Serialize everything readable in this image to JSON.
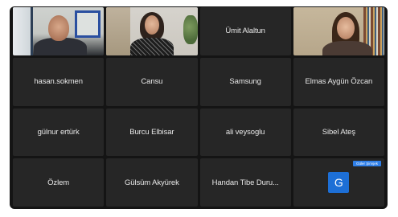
{
  "meeting": {
    "participants": [
      {
        "name": "",
        "type": "video",
        "scene": "man-in-room"
      },
      {
        "name": "",
        "type": "video",
        "scene": "woman-in-office"
      },
      {
        "name": "Ümit Alaltun",
        "type": "name"
      },
      {
        "name": "",
        "type": "video",
        "scene": "woman-with-bookshelf"
      },
      {
        "name": "hasan.sokmen",
        "type": "name"
      },
      {
        "name": "Cansu",
        "type": "name"
      },
      {
        "name": "Samsung",
        "type": "name"
      },
      {
        "name": "Elmas Aygün Özcan",
        "type": "name"
      },
      {
        "name": "gülnur ertürk",
        "type": "name"
      },
      {
        "name": "Burcu Elbisar",
        "type": "name"
      },
      {
        "name": "ali veysoglu",
        "type": "name"
      },
      {
        "name": "Sibel Ateş",
        "type": "name"
      },
      {
        "name": "Özlem",
        "type": "name"
      },
      {
        "name": "Gülsüm Akyürek",
        "type": "name"
      },
      {
        "name": "Handan Tibe Duru...",
        "type": "name"
      },
      {
        "name": "",
        "type": "avatar",
        "avatar_letter": "G",
        "badge": "Güler Şimşek"
      }
    ]
  },
  "colors": {
    "background": "#141414",
    "tile": "#262626",
    "avatar": "#1d6fd6",
    "badge": "#2f7fe8"
  }
}
